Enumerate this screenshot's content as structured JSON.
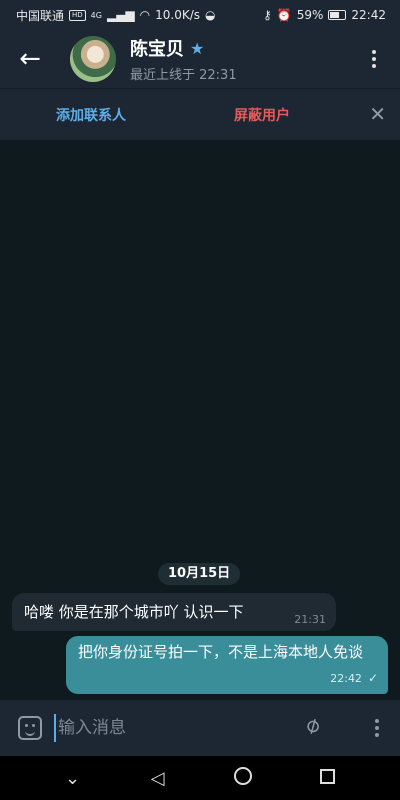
{
  "status_bar": {
    "carrier": "中国联通",
    "hd": "HD",
    "network": "4G",
    "speed": "10.0K/s",
    "battery": "59%",
    "time": "22:42"
  },
  "header": {
    "contact_name": "陈宝贝",
    "last_seen": "最近上线于 22:31"
  },
  "action_bar": {
    "add_contact": "添加联系人",
    "block_user": "屏蔽用户"
  },
  "chat": {
    "date_chip": "10月15日",
    "messages": [
      {
        "direction": "in",
        "text": "哈喽 你是在那个城市吖  认识一下",
        "time": "21:31"
      },
      {
        "direction": "out",
        "text": "把你身份证号拍一下，不是上海本地人免谈",
        "time": "22:42"
      }
    ]
  },
  "input": {
    "placeholder": "输入消息"
  },
  "icons": {
    "back": "arrow-left-icon",
    "verified": "star-icon",
    "menu": "kebab-menu-icon",
    "close": "close-icon",
    "sticker": "sticker-icon",
    "attach": "paperclip-icon",
    "read": "check-icon"
  },
  "colors": {
    "accent": "#5eaee8",
    "danger": "#e35a5a",
    "outgoing_bubble": "#3a8e9a"
  }
}
